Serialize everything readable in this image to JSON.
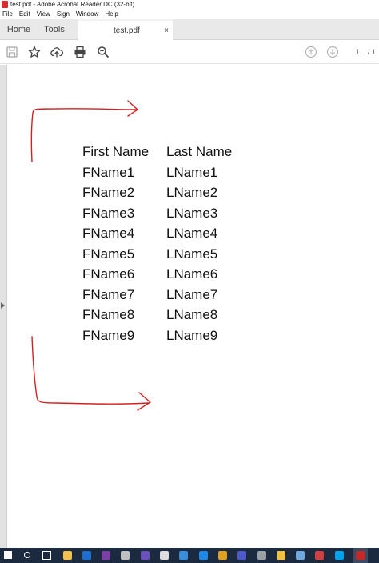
{
  "window": {
    "title": "test.pdf - Adobe Acrobat Reader DC (32-bit)"
  },
  "menu": {
    "items": [
      "File",
      "Edit",
      "View",
      "Sign",
      "Window",
      "Help"
    ]
  },
  "tabs": {
    "home": "Home",
    "tools": "Tools",
    "document": "test.pdf",
    "close_glyph": "×"
  },
  "toolbar": {
    "icons": [
      "save-icon",
      "bookmark-star-icon",
      "upload-cloud-icon",
      "print-icon",
      "zoom-search-icon",
      "page-up-icon",
      "page-down-icon"
    ],
    "page_current": "1",
    "page_total": "/ 1"
  },
  "document": {
    "headers": [
      "First Name",
      "Last Name"
    ],
    "rows": [
      [
        "FName1",
        "LName1"
      ],
      [
        "FName2",
        "LName2"
      ],
      [
        "FName3",
        "LName3"
      ],
      [
        "FName4",
        "LName4"
      ],
      [
        "FName5",
        "LName5"
      ],
      [
        "FName6",
        "LName6"
      ],
      [
        "FName7",
        "LName7"
      ],
      [
        "FName8",
        "LName8"
      ],
      [
        "FName9",
        "LName9"
      ]
    ],
    "annotation_color": "#d42020"
  },
  "taskbar": {
    "icons": [
      "windows-start-icon",
      "search-icon",
      "task-view-icon",
      "file-explorer-icon",
      "outlook-icon",
      "onenote-icon",
      "app-icon",
      "visual-studio-icon",
      "clock-icon",
      "photos-icon",
      "edge-icon",
      "chrome-icon",
      "teams-icon",
      "settings-icon",
      "notes-icon",
      "desktop-icon",
      "app2-icon",
      "skype-icon",
      "acrobat-reader-icon"
    ]
  }
}
